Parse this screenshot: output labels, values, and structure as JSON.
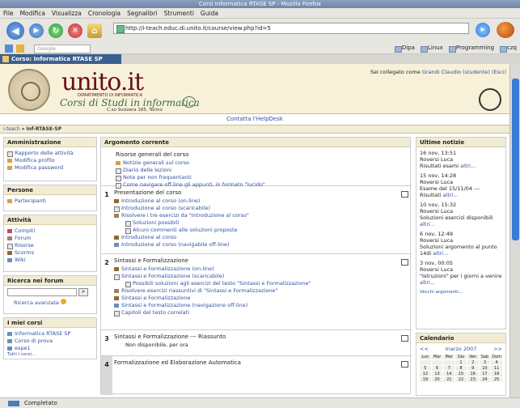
{
  "window": {
    "title": "Corsi Informatica RTASE SP - Mozilla Firefox"
  },
  "menu": [
    "File",
    "Modifica",
    "Visualizza",
    "Cronologia",
    "Segnalibri",
    "Strumenti",
    "Guida"
  ],
  "nav": {
    "url": "http://i-teach.educ.di.unito.it/course/view.php?id=5"
  },
  "search": {
    "placeholder": "Google"
  },
  "bookmarks": [
    "Dipa",
    "Linux",
    "Programming",
    "czq"
  ],
  "tab": {
    "label": "Corso: Informatica RTASE SP"
  },
  "header": {
    "logo": "unito.it",
    "department": "DIPARTIMENTO DI INFORMATICA",
    "subtitle": "Corsi di Studi in informatica",
    "address": "C.so Svizzera 185, Torino",
    "login_prefix": "Sei collegato come",
    "login_user": "Grandi Claudio (studente)",
    "login_logout": "(Esci)",
    "help": "Contatta l'HelpDesk"
  },
  "breadcrumb": {
    "home": "i-teach",
    "sep": "»",
    "course": "Inf-RTASE-SP"
  },
  "left": {
    "admin": {
      "title": "Amministrazione",
      "items": [
        "Rapporto delle attività",
        "Modifica profilo",
        "Modifica password"
      ]
    },
    "people": {
      "title": "Persone",
      "items": [
        "Partecipanti"
      ]
    },
    "activities": {
      "title": "Attività",
      "items": [
        "Compiti",
        "Forum",
        "Risorse",
        "Scorms",
        "Wiki"
      ]
    },
    "search": {
      "title": "Ricerca nei forum",
      "go": ">",
      "advanced": "Ricerca avanzata"
    },
    "mycourses": {
      "title": "I miei corsi",
      "items": [
        "Informatica RTASE SP",
        "Corso di prova",
        "espe1"
      ],
      "all": "Tutti i corsi..."
    }
  },
  "center": {
    "title": "Argomento corrente",
    "sections": [
      {
        "num": "",
        "title": "Risorse generali del corso",
        "items": [
          "Notizie generali sul corso",
          "Diario delle lezioni",
          "Note per non frequentanti",
          "Come navigare off-line gli appunti, in formato \"lucido\""
        ]
      },
      {
        "num": "1",
        "title": "Presentazione del corso",
        "items": [
          "Introduzione al corso (on-line)",
          "Introduzione al corso (scaricabile)",
          "Risolvere i tre esercizi da \"Introduzione al corso\"",
          "Soluzioni possibili",
          "Alcuni commenti alle soluzioni proposte",
          "Introduzione al corso",
          "Introduzione al corso (navigabile off-line)"
        ]
      },
      {
        "num": "2",
        "title": "Sintassi e Formalizzazione",
        "items": [
          "Sintassi e Formalizzazione (on-line)",
          "Sintassi e Formalizzazione (scaricabile)",
          "Possibili soluzioni agli esercizi del testo \"Sintassi e Formalizzazione\"",
          "Risolvere esercizi riassuntivi di \"Sintassi e Formalizzazione\"",
          "Sintassi e Formalizzazione",
          "Sintassi e Formalizzazione (navigazione off-line)",
          "Capitoli del testo correlati"
        ]
      },
      {
        "num": "3",
        "title": "Sintassi e Formalizzazione --- Riassunto",
        "items": [
          "Non disponibile, per ora"
        ]
      },
      {
        "num": "4",
        "title": "Formalizzazione ed Elaborazione Automatica",
        "items": []
      }
    ]
  },
  "right": {
    "news": {
      "title": "Ultime notizie",
      "entries": [
        {
          "date": "16 nov, 13:51",
          "author": "Roversi Luca",
          "text": "Risultati esami",
          "more": "altri..."
        },
        {
          "date": "15 nov, 14:28",
          "author": "Roversi Luca",
          "text": "Esame del 15/11/04 --- Risultati",
          "more": "altri..."
        },
        {
          "date": "10 nov, 15:32",
          "author": "Roversi Luca",
          "text": "Soluzioni esercizi disponibili",
          "more": "altri..."
        },
        {
          "date": "6 nov, 12:49",
          "author": "Roversi Luca",
          "text": "Soluzioni argomento al punto 14di",
          "more": "altri..."
        },
        {
          "date": "3 nov, 00:05",
          "author": "Roversi Luca",
          "text": "\"Istruzioni\" per i giorni a venire",
          "more": "altri..."
        }
      ],
      "older": "Vecchi argomenti..."
    },
    "calendar": {
      "title": "Calendario",
      "prev": "<<",
      "month": "marzo 2007",
      "next": ">>",
      "days": [
        "Lun",
        "Mar",
        "Mer",
        "Gio",
        "Ven",
        "Sab",
        "Dom"
      ],
      "cells": [
        "",
        "",
        "",
        "1",
        "2",
        "3",
        "4",
        "5",
        "6",
        "7",
        "8",
        "9",
        "10",
        "11",
        "12",
        "13",
        "14",
        "15",
        "16",
        "17",
        "18",
        "19",
        "20",
        "21",
        "22",
        "23",
        "24",
        "25"
      ]
    }
  },
  "status": {
    "text": "Completato"
  }
}
